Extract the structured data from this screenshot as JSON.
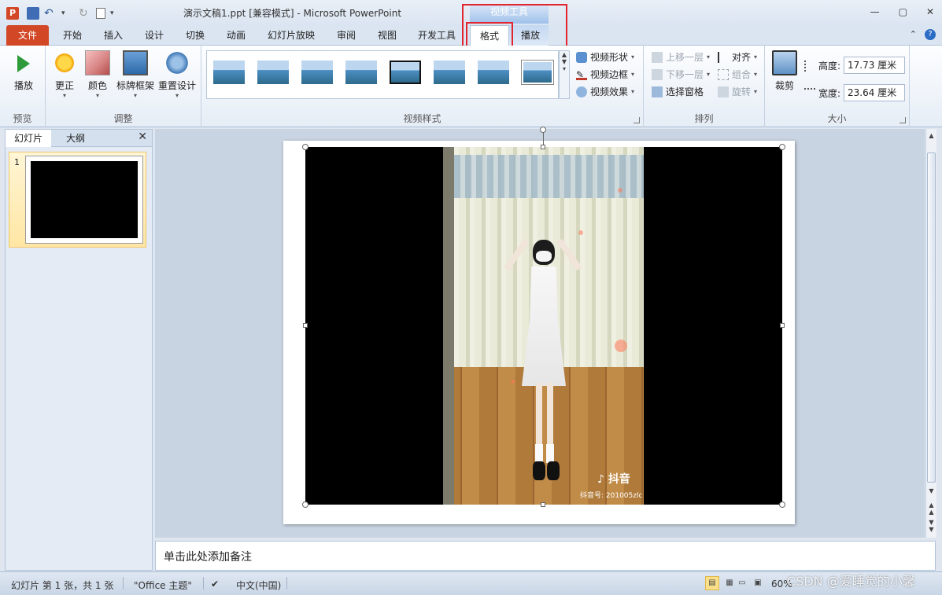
{
  "window": {
    "title": "演示文稿1.ppt [兼容模式]  -  Microsoft PowerPoint",
    "context_group": "视频工具"
  },
  "tabs": {
    "file": "文件",
    "items": [
      "开始",
      "插入",
      "设计",
      "切换",
      "动画",
      "幻灯片放映",
      "审阅",
      "视图",
      "开发工具",
      "格式",
      "播放"
    ],
    "active": "格式"
  },
  "ribbon": {
    "preview": {
      "play": "播放",
      "label": "预览"
    },
    "adjust": {
      "correct": "更正",
      "color": "颜色",
      "poster_frame": "标牌框架",
      "reset": "重置设计",
      "label": "调整"
    },
    "styles": {
      "label": "视频样式",
      "shape": "视频形状",
      "border": "视频边框",
      "effects": "视频效果"
    },
    "arrange": {
      "label": "排列",
      "bring_forward": "上移一层",
      "send_backward": "下移一层",
      "selection_pane": "选择窗格",
      "align": "对齐",
      "group": "组合",
      "rotate": "旋转"
    },
    "size": {
      "label": "大小",
      "crop": "裁剪",
      "height_label": "高度:",
      "height_value": "17.73 厘米",
      "width_label": "宽度:",
      "width_value": "23.64 厘米"
    }
  },
  "left_pane": {
    "tab_slides": "幻灯片",
    "tab_outline": "大纲",
    "close": "✕",
    "slide_number": "1"
  },
  "video": {
    "app_name": "抖音",
    "account": "抖音号: 201005zlc"
  },
  "notes": {
    "placeholder": "单击此处添加备注"
  },
  "status": {
    "slide_info": "幻灯片 第 1 张，共 1 张",
    "theme": "\"Office 主题\"",
    "language": "中文(中国)",
    "zoom": "60%"
  },
  "watermark": "CSDN @爱睡觉的小馨"
}
